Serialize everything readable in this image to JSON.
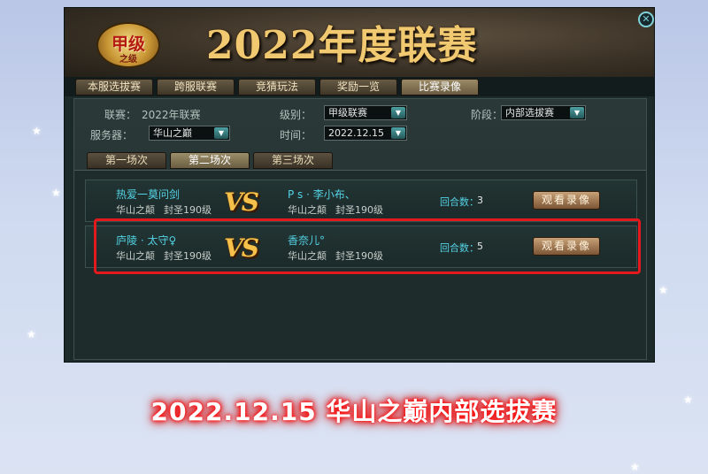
{
  "colors": {
    "background": "#cfdaf0",
    "highlight_border": "#e3191e",
    "player_name": "#53d2e4",
    "banner_title": "#f0c971"
  },
  "window": {
    "logo": {
      "main": "甲级",
      "sub": "之级"
    },
    "banner_title": "2022年度联赛",
    "close_icon": "✕"
  },
  "main_tabs": [
    {
      "label": "本服选拔赛",
      "active": false
    },
    {
      "label": "跨服联赛",
      "active": false
    },
    {
      "label": "竞猜玩法",
      "active": false
    },
    {
      "label": "奖励一览",
      "active": false
    },
    {
      "label": "比赛录像",
      "active": true
    }
  ],
  "filters": {
    "league_label": "联赛：",
    "league_value": "2022年联赛",
    "server_label": "服务器：",
    "server_value": "华山之巅",
    "level_label": "级别：",
    "level_value": "甲级联赛",
    "time_label": "时间：",
    "time_value": "2022.12.15",
    "stage_label": "阶段：",
    "stage_value": "内部选拔赛"
  },
  "round_tabs": [
    {
      "label": "第一场次",
      "active": false
    },
    {
      "label": "第二场次",
      "active": true
    },
    {
      "label": "第三场次",
      "active": false
    }
  ],
  "matches": [
    {
      "player1": {
        "name": "热爱一莫问剑",
        "server": "华山之颠",
        "rank": "封圣190级"
      },
      "vs": "VS",
      "player2": {
        "name": "P s · 李小布、",
        "server": "华山之颠",
        "rank": "封圣190级"
      },
      "rounds_label": "回合数：",
      "rounds": "3",
      "watch_button": "观看录像",
      "highlighted": false
    },
    {
      "player1": {
        "name": "庐陵 · 太守♀",
        "server": "华山之颠",
        "rank": "封圣190级"
      },
      "vs": "VS",
      "player2": {
        "name": "香奈儿°",
        "server": "华山之颠",
        "rank": "封圣190级"
      },
      "rounds_label": "回合数：",
      "rounds": "5",
      "watch_button": "观看录像",
      "highlighted": true
    }
  ],
  "caption": "2022.12.15 华山之巅内部选拔赛"
}
